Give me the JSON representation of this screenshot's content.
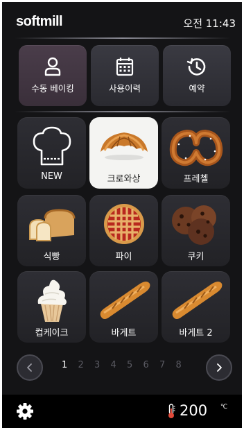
{
  "header": {
    "brand": "softmill",
    "clock": "오전 11:43"
  },
  "top_buttons": [
    {
      "label": "수동 베이킹",
      "icon": "person-icon"
    },
    {
      "label": "사용이력",
      "icon": "calendar-icon"
    },
    {
      "label": "예약",
      "icon": "history-clock-icon"
    }
  ],
  "recipes": [
    {
      "label": "NEW",
      "icon": "chef-hat-icon"
    },
    {
      "label": "크로와상",
      "icon": "croissant-icon",
      "selected": true
    },
    {
      "label": "프레첼",
      "icon": "pretzel-icon"
    },
    {
      "label": "식빵",
      "icon": "bread-loaf-icon"
    },
    {
      "label": "파이",
      "icon": "pie-icon"
    },
    {
      "label": "쿠키",
      "icon": "cookie-icon"
    },
    {
      "label": "컵케이크",
      "icon": "cupcake-icon"
    },
    {
      "label": "바게트",
      "icon": "baguette-icon"
    },
    {
      "label": "바게트 2",
      "icon": "baguette-icon"
    }
  ],
  "pager": {
    "pages": [
      "1",
      "2",
      "3",
      "4",
      "5",
      "6",
      "7",
      "8"
    ],
    "current_page": "1"
  },
  "footer": {
    "temperature": "200",
    "unit": "℃"
  },
  "colors": {
    "background": "#141416",
    "tile": "#2a2a30",
    "selected_tile": "#f4f4f2",
    "footer": "#000000"
  }
}
